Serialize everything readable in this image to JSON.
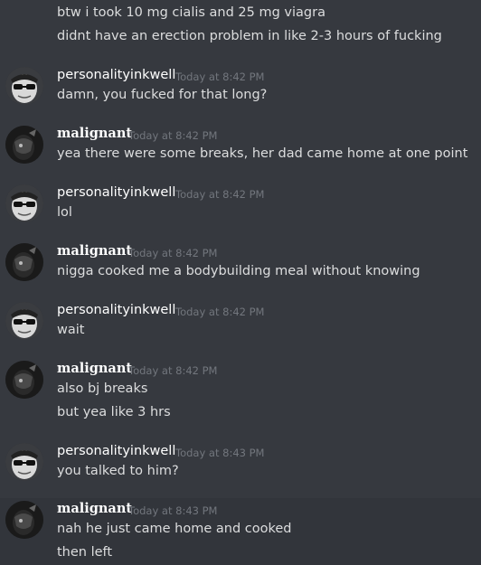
{
  "top_messages": [
    "btw i took 10 mg cialis and 25 mg viagra",
    "didnt have an erection problem in like 2-3 hours of fucking"
  ],
  "groups": [
    {
      "user": "personalityinkwell",
      "time": "Today at 8:42 PM",
      "lines": [
        "damn, you fucked for that long?"
      ]
    },
    {
      "user": "malignant",
      "time": "Today at 8:42 PM",
      "lines": [
        "yea there were some breaks, her dad came home at one point"
      ]
    },
    {
      "user": "personalityinkwell",
      "time": "Today at 8:42 PM",
      "lines": [
        "lol"
      ]
    },
    {
      "user": "malignant",
      "time": "Today at 8:42 PM",
      "lines": [
        "nigga cooked me a bodybuilding meal without knowing"
      ]
    },
    {
      "user": "personalityinkwell",
      "time": "Today at 8:42 PM",
      "lines": [
        "wait"
      ]
    },
    {
      "user": "malignant",
      "time": "Today at 8:42 PM",
      "lines": [
        "also bj breaks",
        "but yea like 3 hrs"
      ]
    },
    {
      "user": "personalityinkwell",
      "time": "Today at 8:43 PM",
      "lines": [
        "you talked to him?"
      ]
    },
    {
      "user": "malignant",
      "time": "Today at 8:43 PM",
      "lines": [
        "nah he just came home and cooked",
        "then left"
      ]
    }
  ],
  "colors": {
    "background": "#36393f",
    "text": "#dcddde",
    "timestamp": "#72767d",
    "username": "#ffffff"
  }
}
